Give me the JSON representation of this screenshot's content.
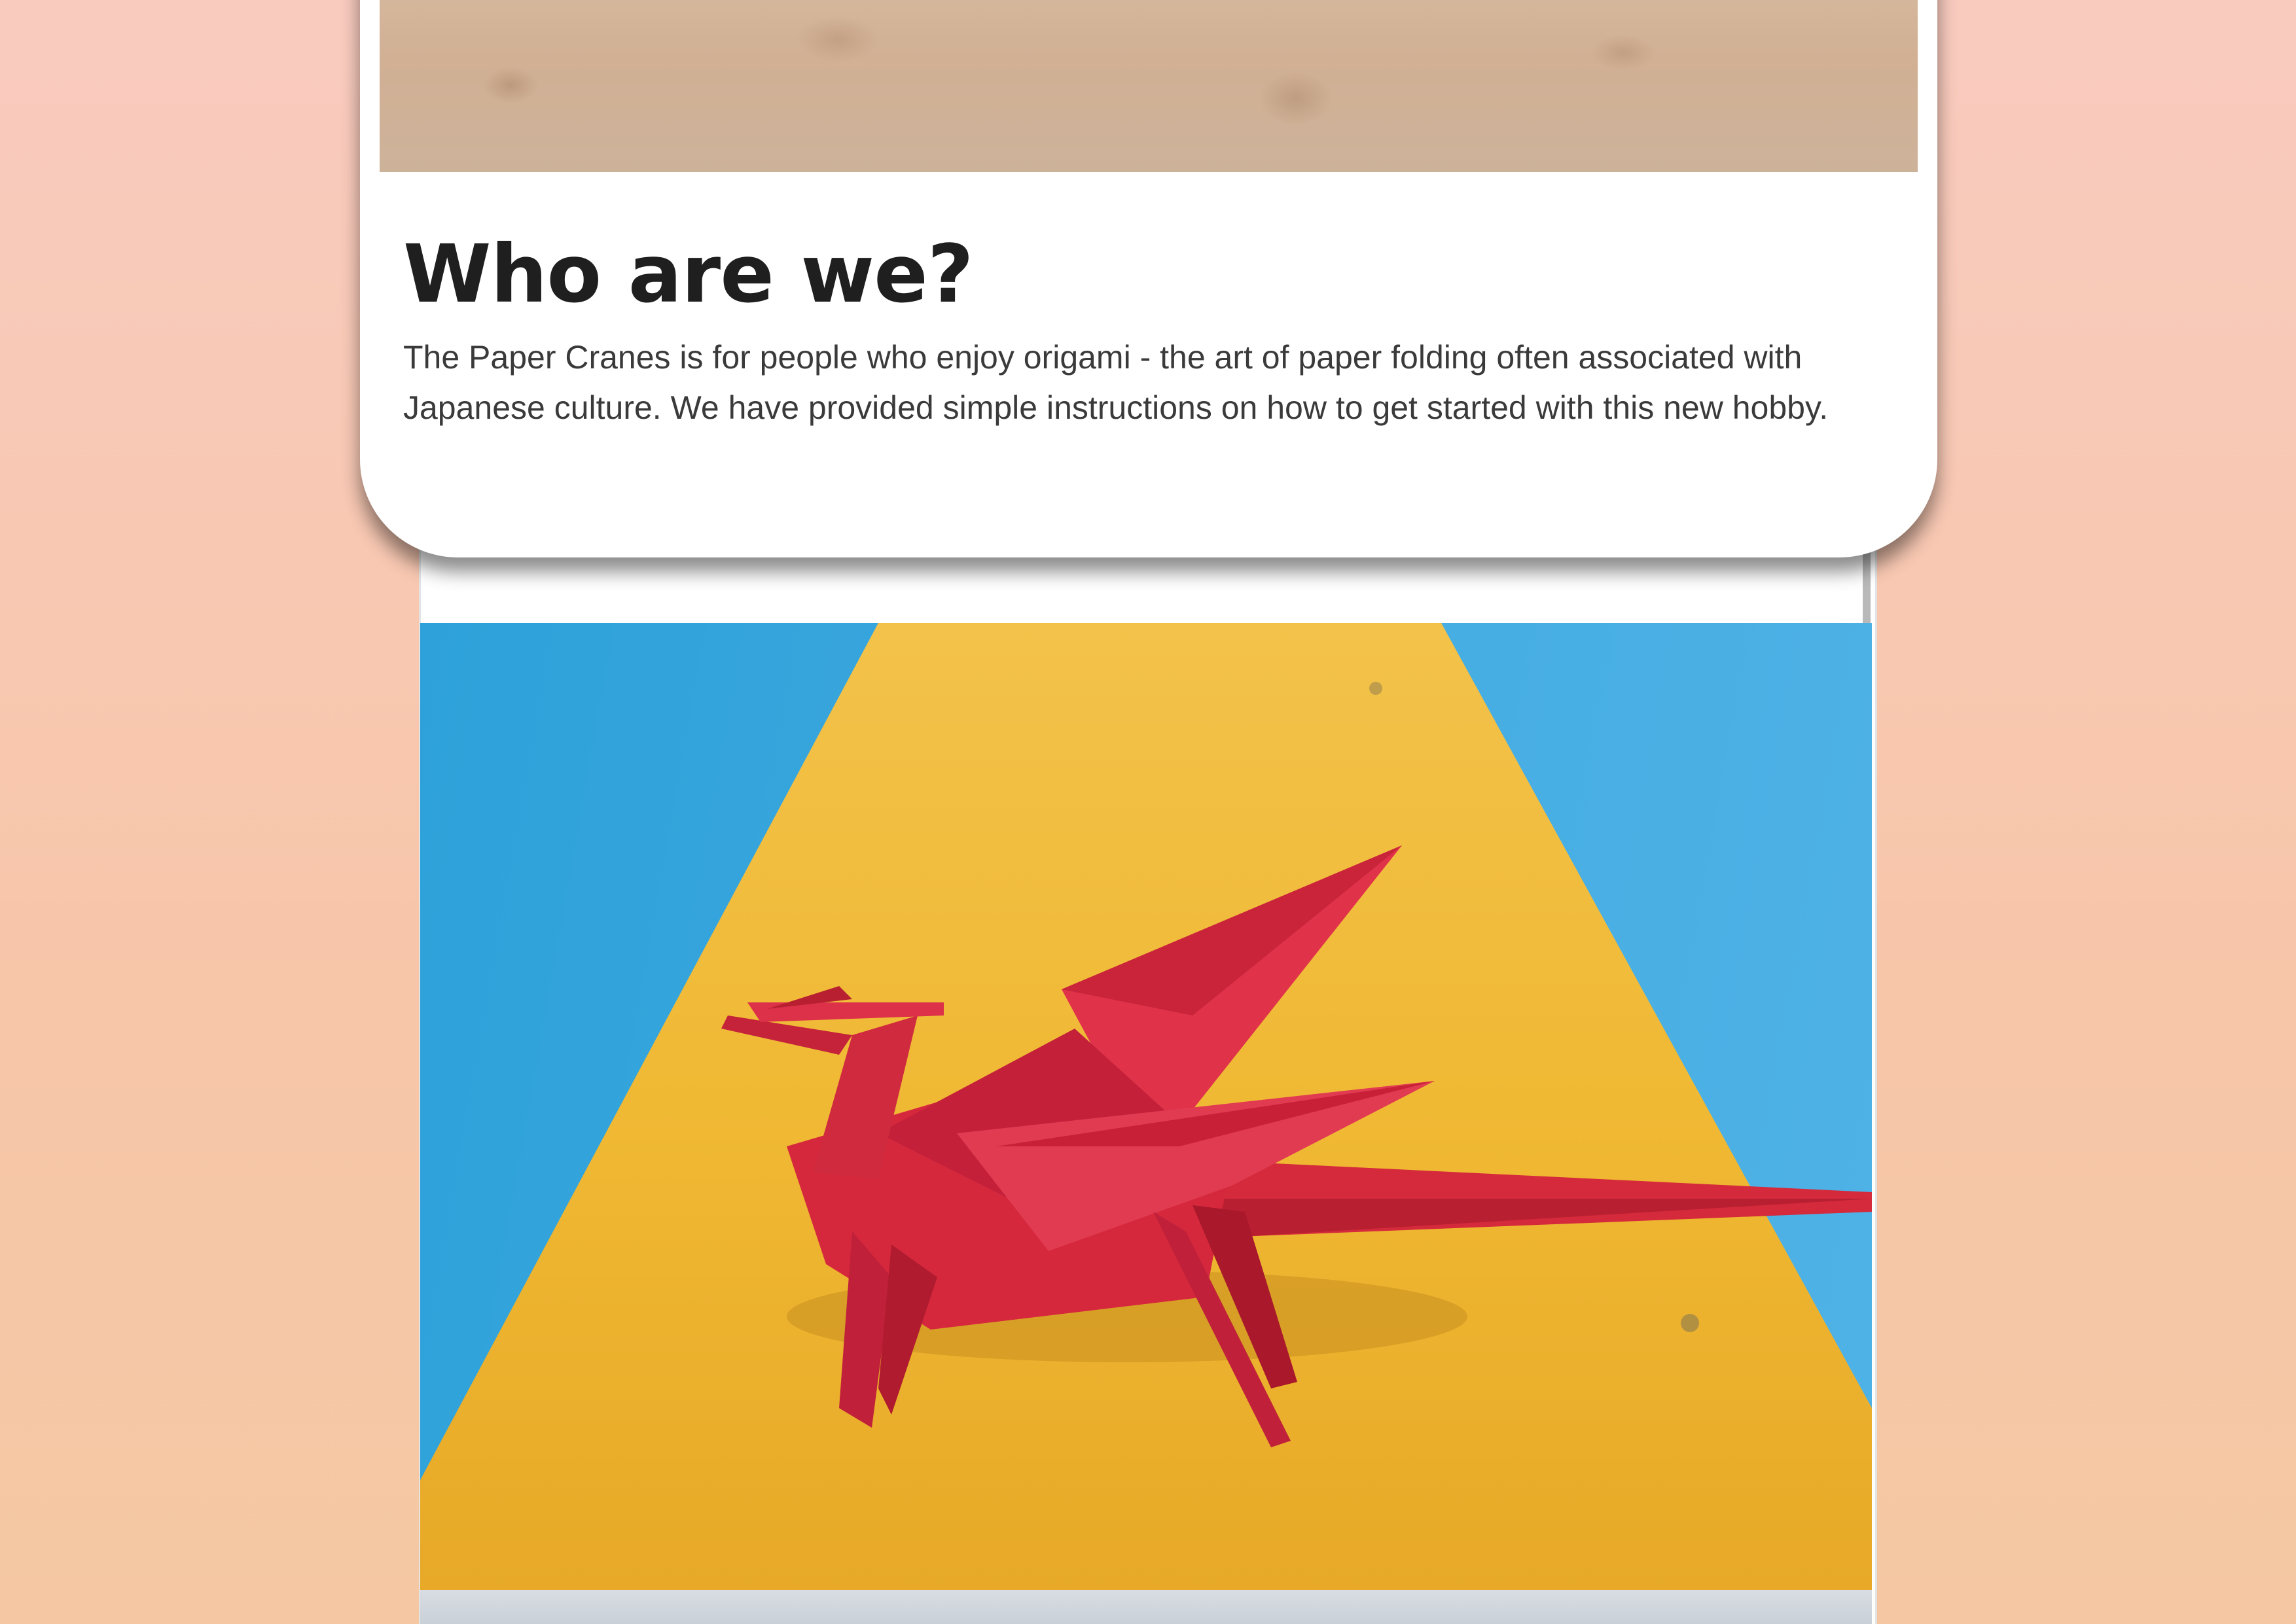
{
  "colors": {
    "page_background": "#f8c9b3",
    "card_background": "#ffffff",
    "heading_color": "#1f1f1f",
    "body_text_color": "#3a3a3a"
  },
  "about": {
    "heading": "Who are we?",
    "body": "The Paper Cranes is for people who enjoy origami - the art of paper folding often associated with Japanese culture. We have provided simple instructions on how to get started with this new hobby."
  }
}
